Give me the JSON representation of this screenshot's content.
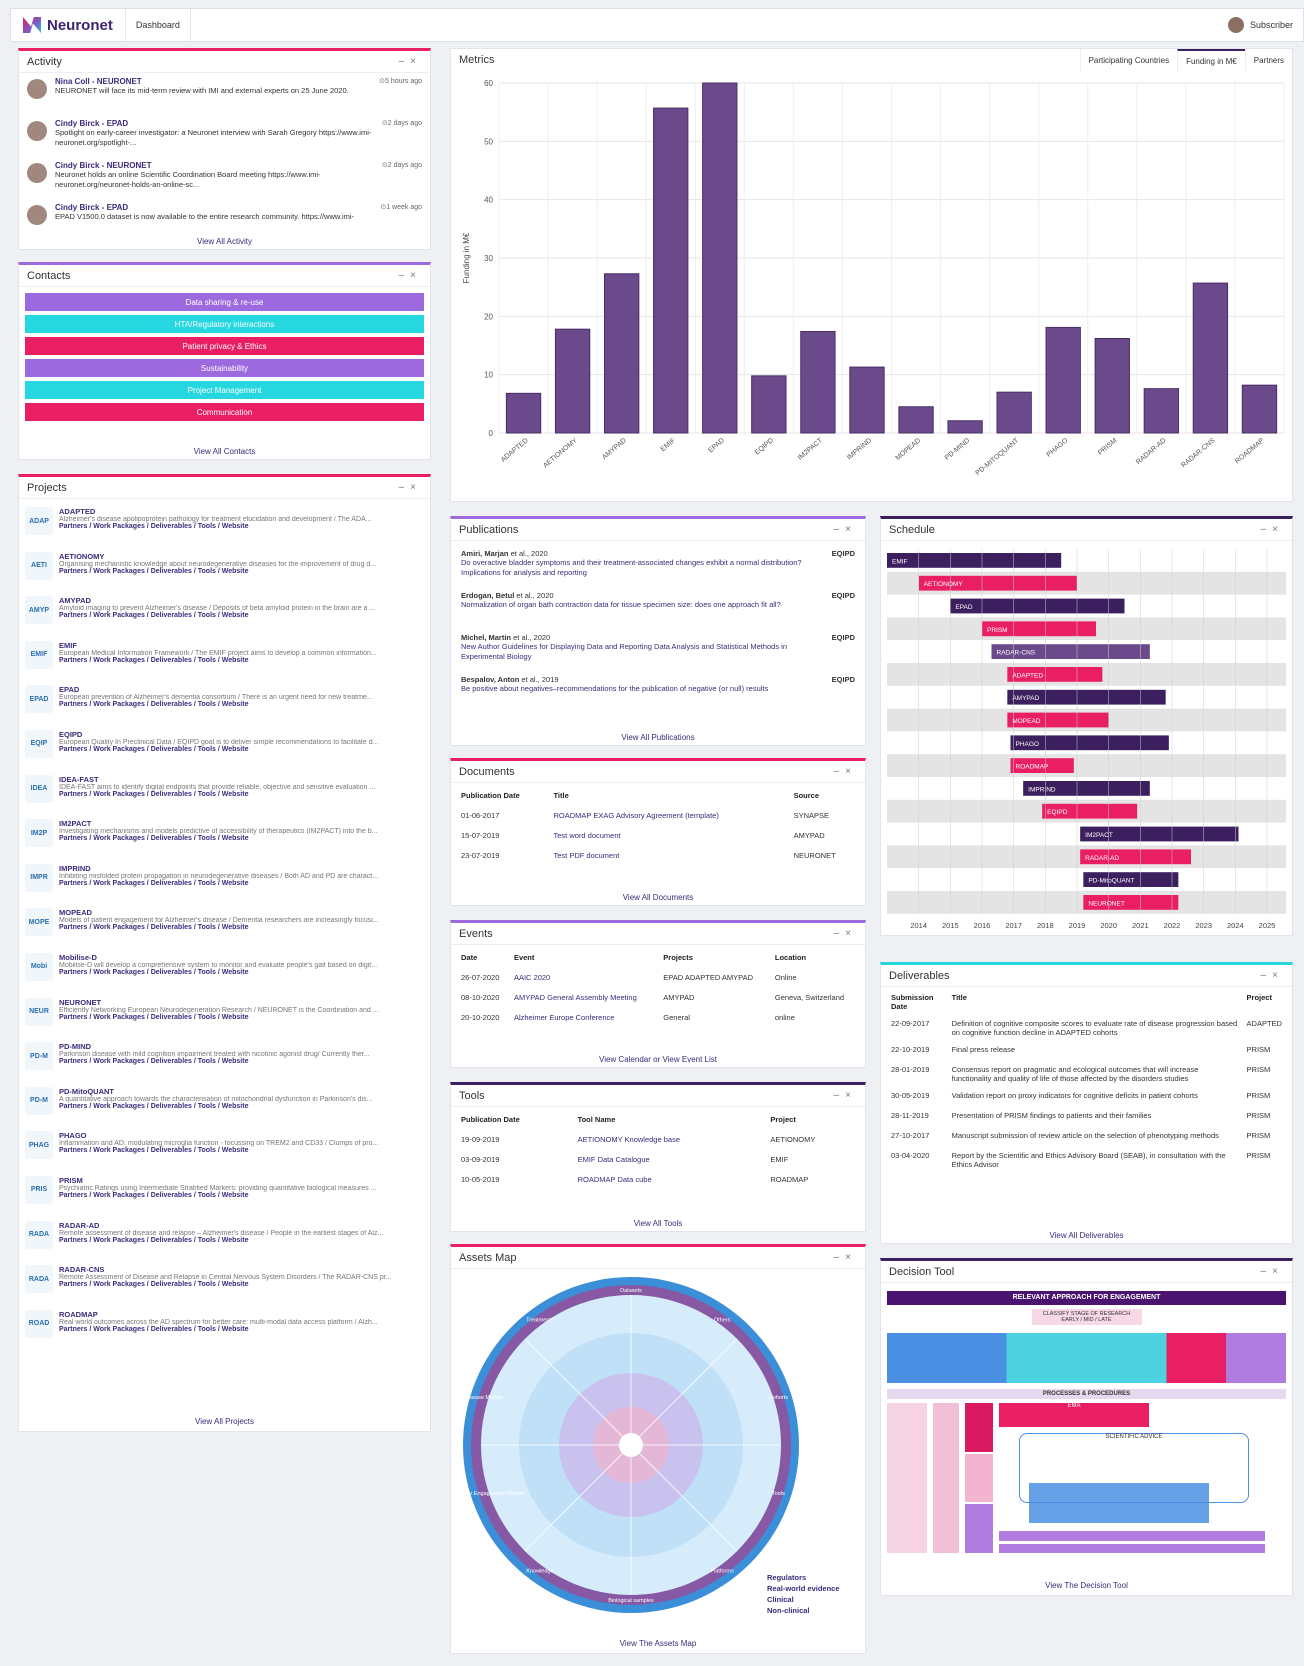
{
  "topbar": {
    "brand": "Neuronet",
    "tab": "Dashboard",
    "user": "Subscriber"
  },
  "activity": {
    "title": "Activity",
    "view_all": "View All Activity",
    "items": [
      {
        "name": "Nina Coll - NEURONET",
        "time": "⊙5 hours ago",
        "text": "NEURONET will face its mid-term review with IMI and external experts on 25 June 2020."
      },
      {
        "name": "Cindy Birck - EPAD",
        "time": "⊙2 days ago",
        "text": "Spotlight on early-career investigator: a Neuronet interview with Sarah Gregory https://www.imi-neuronet.org/spotlight-..."
      },
      {
        "name": "Cindy Birck - NEURONET",
        "time": "⊙2 days ago",
        "text": "Neuronet holds an online Scientific Coordination Board meeting https://www.imi-neuronet.org/neuronet-holds-an-online-sc..."
      },
      {
        "name": "Cindy Birck - EPAD",
        "time": "⊙1 week ago",
        "text": "EPAD V1500.0 dataset is now available to the entire research community. https://www.imi-"
      }
    ]
  },
  "contacts": {
    "title": "Contacts",
    "view_all": "View All Contacts",
    "items": [
      {
        "label": "Data sharing & re-use",
        "color": "#9c6ade"
      },
      {
        "label": "HTA/Regulatory interactions",
        "color": "#26d7e0"
      },
      {
        "label": "Patient privacy & Ethics",
        "color": "#e91e63"
      },
      {
        "label": "Sustainability",
        "color": "#9c6ade"
      },
      {
        "label": "Project Management",
        "color": "#26d7e0"
      },
      {
        "label": "Communication",
        "color": "#e91e63"
      }
    ]
  },
  "projects": {
    "title": "Projects",
    "view_all": "View All Projects",
    "links": "Partners / Work Packages / Deliverables / Tools / Website",
    "items": [
      {
        "name": "ADAPTED",
        "desc": "Alzheimer's disease apolipoprotein pathology for treatment elucidation and development / The ADA..."
      },
      {
        "name": "AETIONOMY",
        "desc": "Organising mechanistic knowledge about neurodegenerative diseases for the improvement of drug d..."
      },
      {
        "name": "AMYPAD",
        "desc": "Amyloid imaging to prevent Alzheimer's disease / Deposits of beta amyloid protein in the brain are a ..."
      },
      {
        "name": "EMIF",
        "desc": "European Medical Information Framework / The EMIF project aims to develop a common information..."
      },
      {
        "name": "EPAD",
        "desc": "European prevention of Alzheimer's dementia consortium / There is an urgent need for new treatme..."
      },
      {
        "name": "EQIPD",
        "desc": "European Quality In Preclinical Data / EQIPD goal is to deliver simple recommendations to facilitate d..."
      },
      {
        "name": "IDEA-FAST",
        "desc": "IDEA-FAST aims to identify digital endpoints that provide reliable, objective and sensitive evaluation ..."
      },
      {
        "name": "IM2PACT",
        "desc": "Investigating mechanisms and models predictive of accessibility of therapeutics (IM2PACT) into the b..."
      },
      {
        "name": "IMPRIND",
        "desc": "Inhibiting misfolded protein propagation in neurodegenerative diseases / Both AD and PD are charact..."
      },
      {
        "name": "MOPEAD",
        "desc": "Models of patient engagement for Alzheimer's disease / Dementia researchers are increasingly focusi..."
      },
      {
        "name": "Mobilise-D",
        "desc": "Mobilise-D will develop a comprehensive system to monitor and evaluate people's gait based on digit..."
      },
      {
        "name": "NEURONET",
        "desc": "Efficiently Networking European Neurodegeneration Research / NEURONET is the Coordination and ..."
      },
      {
        "name": "PD-MIND",
        "desc": "Parkinson disease with mild cognition impairment treated with nicotinic agonist drug/ Currently ther..."
      },
      {
        "name": "PD-MitoQUANT",
        "desc": "A quantitative approach towards the characterisation of mitochondrial dysfunction in Parkinson's dis..."
      },
      {
        "name": "PHAGO",
        "desc": "Inflammation and AD: modulating microglia function - focussing on TREM2 and CD33 / Clumps of pro..."
      },
      {
        "name": "PRISM",
        "desc": "Psychiatric Ratings using Intermediate Stratified Markers: providing quantitative biological measures ..."
      },
      {
        "name": "RADAR-AD",
        "desc": "Remote assessment of disease and relapse – Alzheimer's disease / People in the earliest stages of Alz..."
      },
      {
        "name": "RADAR-CNS",
        "desc": "Remote Assessment of Disease and Relapse in Central Nervous System Disorders / The RADAR-CNS pr..."
      },
      {
        "name": "ROADMAP",
        "desc": "Real world outcomes across the AD spectrum for better care: multi-modal data access platform / Alzh..."
      }
    ]
  },
  "metrics": {
    "title": "Metrics",
    "tabs": [
      "Participating Countries",
      "Funding in M€",
      "Partners"
    ]
  },
  "chart_data": {
    "type": "bar",
    "ylabel": "Funding in M€",
    "ylim": [
      0,
      60
    ],
    "yticks": [
      0,
      10,
      20,
      30,
      40,
      50,
      60
    ],
    "categories": [
      "ADAPTED",
      "AETIONOMY",
      "AMYPAD",
      "EMIF",
      "EPAD",
      "EQIPD",
      "IM2PACT",
      "IMPRIND",
      "MOPEAD",
      "PD-MIND",
      "PD-MITOQUANT",
      "PHAGO",
      "PRISM",
      "RADAR-AD",
      "RADAR-CNS",
      "ROADMAP"
    ],
    "values": [
      6.8,
      17.8,
      27.3,
      55.7,
      60,
      9.8,
      17.4,
      11.3,
      4.5,
      2.1,
      7,
      18.1,
      16.2,
      7.6,
      25.7,
      8.2
    ],
    "color": "#6b4a8b"
  },
  "publications": {
    "title": "Publications",
    "view_all": "View All Publications",
    "items": [
      {
        "author": "Amiri, Marjan",
        "etal": " et al., 2020",
        "title": "Do overactive bladder symptoms and their treatment-associated changes exhibit a normal distribution? Implications for analysis and reporting",
        "project": "EQIPD"
      },
      {
        "author": "Erdogan, Betul",
        "etal": " et al., 2020",
        "title": "Normalization of organ bath contraction data for tissue specimen size: does one approach fit all?",
        "project": "EQIPD"
      },
      {
        "author": "Michel, Martin",
        "etal": " et al., 2020",
        "title": "New Author Guidelines for Displaying Data and Reporting Data Analysis and Statistical Methods in Experimental Biology",
        "project": "EQIPD"
      },
      {
        "author": "Bespalov, Anton",
        "etal": " et al., 2019",
        "title": "Be positive about negatives–recommendations for the publication of negative (or null) results",
        "project": "EQIPD"
      }
    ]
  },
  "documents": {
    "title": "Documents",
    "view_all": "View All Documents",
    "headers": [
      "Publication Date",
      "Title",
      "Source"
    ],
    "rows": [
      [
        "01-06-2017",
        "ROADMAP EXAG Advisory Agreement (template)",
        "SYNAPSE"
      ],
      [
        "15-07-2019",
        "Test word document",
        "AMYPAD"
      ],
      [
        "23-07-2019",
        "Test PDF document",
        "NEURONET"
      ]
    ]
  },
  "events": {
    "title": "Events",
    "view_all": "View Calendar or View Event List",
    "headers": [
      "Date",
      "Event",
      "Projects",
      "Location"
    ],
    "rows": [
      [
        "26-07-2020",
        "AAIC 2020",
        "EPAD ADAPTED AMYPAD",
        "Online"
      ],
      [
        "08-10-2020",
        "AMYPAD General Assembly Meeting",
        "AMYPAD",
        "Geneva, Switzerland"
      ],
      [
        "20-10-2020",
        "Alzheimer Europe Conference",
        "General",
        "online"
      ]
    ]
  },
  "tools": {
    "title": "Tools",
    "view_all": "View All Tools",
    "headers": [
      "Publication Date",
      "Tool Name",
      "Project"
    ],
    "rows": [
      [
        "19-09-2019",
        "AETIONOMY Knowledge base",
        "AETIONOMY"
      ],
      [
        "03-09-2019",
        "EMIF Data Catalogue",
        "EMIF"
      ],
      [
        "10-05-2019",
        "ROADMAP Data cube",
        "ROADMAP"
      ]
    ]
  },
  "schedule": {
    "title": "Schedule",
    "years": [
      "2014",
      "2015",
      "2016",
      "2017",
      "2018",
      "2019",
      "2020",
      "2021",
      "2022",
      "2023",
      "2024",
      "2025"
    ],
    "bars": [
      {
        "name": "EMIF",
        "start": 2013.0,
        "end": 2018.5,
        "color": "#3c1f5e"
      },
      {
        "name": "AETIONOMY",
        "start": 2014.0,
        "end": 2019.0,
        "color": "#e91e63"
      },
      {
        "name": "EPAD",
        "start": 2015.0,
        "end": 2020.5,
        "color": "#3c1f5e"
      },
      {
        "name": "PRISM",
        "start": 2016.0,
        "end": 2019.6,
        "color": "#e91e63"
      },
      {
        "name": "RADAR-CNS",
        "start": 2016.3,
        "end": 2021.3,
        "color": "#6b4a8b"
      },
      {
        "name": "ADAPTED",
        "start": 2016.8,
        "end": 2019.8,
        "color": "#e91e63"
      },
      {
        "name": "AMYPAD",
        "start": 2016.8,
        "end": 2021.8,
        "color": "#3c1f5e"
      },
      {
        "name": "MOPEAD",
        "start": 2016.8,
        "end": 2020.0,
        "color": "#e91e63"
      },
      {
        "name": "PHAGO",
        "start": 2016.9,
        "end": 2021.9,
        "color": "#3c1f5e"
      },
      {
        "name": "ROADMAP",
        "start": 2016.9,
        "end": 2018.9,
        "color": "#e91e63"
      },
      {
        "name": "IMPRIND",
        "start": 2017.3,
        "end": 2021.3,
        "color": "#3c1f5e"
      },
      {
        "name": "EQIPD",
        "start": 2017.9,
        "end": 2020.9,
        "color": "#e91e63"
      },
      {
        "name": "IM2PACT",
        "start": 2019.1,
        "end": 2024.1,
        "color": "#3c1f5e"
      },
      {
        "name": "RADAR-AD",
        "start": 2019.1,
        "end": 2022.6,
        "color": "#e91e63"
      },
      {
        "name": "PD-MitoQUANT",
        "start": 2019.2,
        "end": 2022.2,
        "color": "#3c1f5e"
      },
      {
        "name": "NEURONET",
        "start": 2019.2,
        "end": 2022.2,
        "color": "#e91e63"
      }
    ]
  },
  "deliverables": {
    "title": "Deliverables",
    "view_all": "View All Deliverables",
    "headers": [
      "Submission Date",
      "Title",
      "Project"
    ],
    "rows": [
      [
        "22-09-2017",
        "Definition of cognitive composite scores to evaluate rate of disease progression based on cognitive function decline in ADAPTED cohorts",
        "ADAPTED"
      ],
      [
        "22-10-2019",
        "Final press release",
        "PRISM"
      ],
      [
        "28-01-2019",
        "Consensus report on pragmatic and ecological outcomes that will increase functionality and quality of life of those affected by the disorders studies",
        "PRISM"
      ],
      [
        "30-05-2019",
        "Validation report on proxy indicators for cognitive deficits in patient cohorts",
        "PRISM"
      ],
      [
        "28-11-2019",
        "Presentation of PRISM findings to patients and their families",
        "PRISM"
      ],
      [
        "27-10-2017",
        "Manuscript submission of review article on the selection of phenotyping methods",
        "PRISM"
      ],
      [
        "03-04-2020",
        "Report by the Scientific and Ethics Advisory Board (SEAB), in consultation with the Ethics Advisor",
        "PRISM"
      ]
    ]
  },
  "assets": {
    "title": "Assets Map",
    "view_all": "View The Assets Map",
    "legend": [
      "Regulators",
      "Real-world evidence",
      "Clinical",
      "Non-clinical"
    ],
    "ring_labels": [
      "Datasets",
      "Others",
      "Cohorts",
      "Tools",
      "Platforms",
      "Biological samples",
      "Knowledge",
      "Stakeholder Engagement Models",
      "Disease Models",
      "Treatments"
    ]
  },
  "decision": {
    "title": "Decision Tool",
    "view_all": "View The Decision Tool",
    "heading": "RELEVANT APPROACH FOR ENGAGEMENT",
    "sub": "CLASSIFY STAGE OF RESEARCH EARLY / MID / LATE",
    "processes": "PROCESSES & PROCEDURES",
    "sci": "SCIENTIFIC ADVICE",
    "ema": "EMA",
    "hta": "HTA",
    "reg": "REGULATORY",
    "joint": "JOINT / PARALLEL"
  }
}
